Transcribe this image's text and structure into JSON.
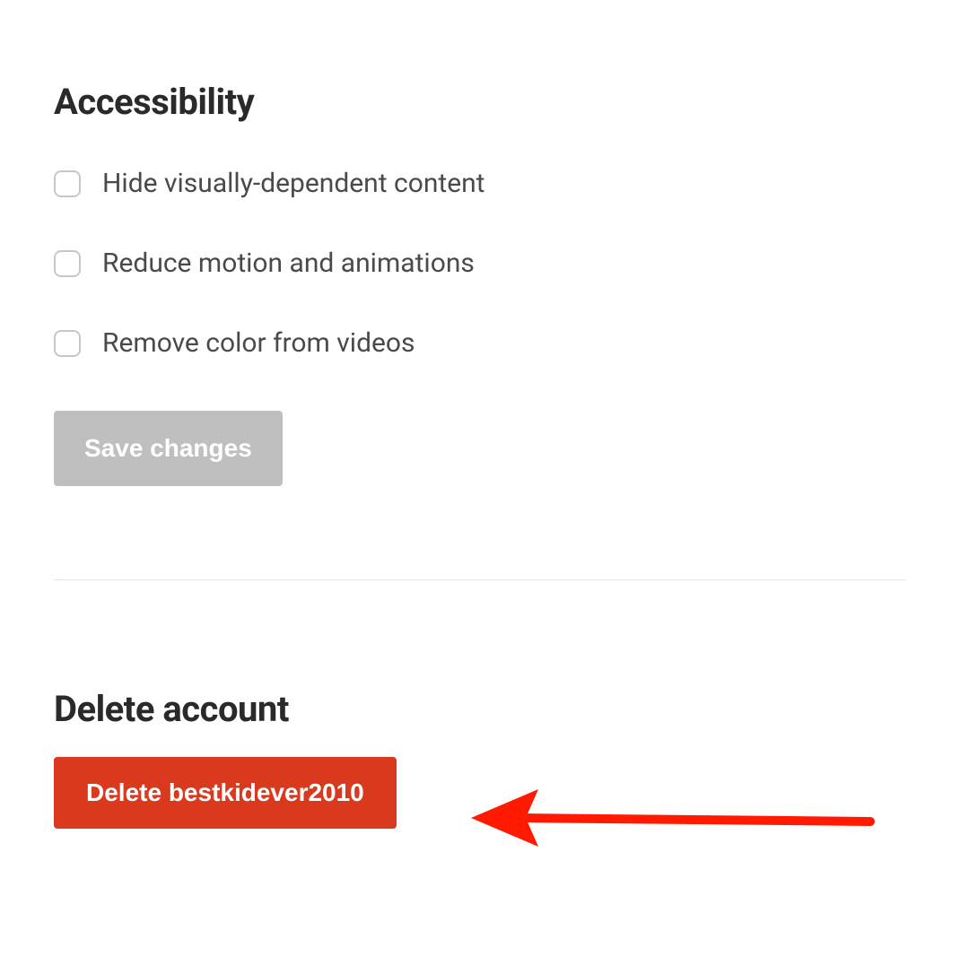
{
  "accessibility": {
    "heading": "Accessibility",
    "options": [
      {
        "label": "Hide visually-dependent content",
        "checked": false
      },
      {
        "label": "Reduce motion and animations",
        "checked": false
      },
      {
        "label": "Remove color from videos",
        "checked": false
      }
    ],
    "save_label": "Save changes",
    "save_enabled": false
  },
  "delete": {
    "heading": "Delete account",
    "button_label": "Delete bestkidever2010"
  },
  "colors": {
    "danger": "#d93a1e",
    "disabled": "#bfbfbf",
    "text_heading": "#2a2a2a",
    "text_body": "#4a4a4a",
    "annotation": "#ff1a00"
  }
}
